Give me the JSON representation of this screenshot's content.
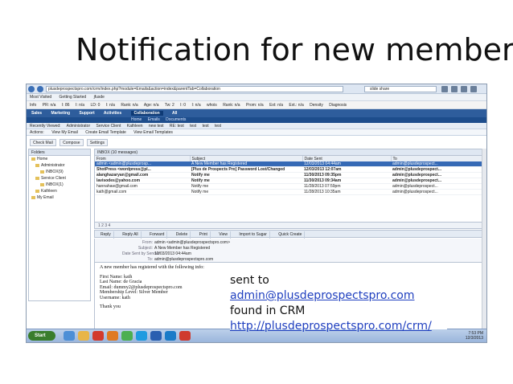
{
  "slide": {
    "title": "Notification for new member"
  },
  "browser": {
    "url": "plusdeprospectspro.com/crm/index.php?module=Emails&action=index&parentTab=Collaboration",
    "search_value": "slide share",
    "bookmarks": [
      "Most Visited",
      "Getting Started",
      "jfusde"
    ],
    "extensions": [
      "Info",
      "PR: n/a",
      "I: 86",
      "I: n/a",
      "LD: 0",
      "I: n/a",
      "Rank: n/a",
      "Age: n/a",
      "Tw: 2",
      "I: 0",
      "I: n/a",
      "whois",
      "Rank: n/a",
      "Prom: n/a",
      "Ext: n/a",
      "Ext.: n/a",
      "Density",
      "Diagnosis"
    ]
  },
  "crm": {
    "tabs": [
      "Sales",
      "Marketing",
      "Support",
      "Activities",
      "Collaboration",
      "All"
    ],
    "active_tab": "Collaboration",
    "subtabs": [
      "Home",
      "Emails",
      "Documents"
    ],
    "recent_label": "Recently Viewed:",
    "recent_items": [
      "Administrator",
      "Service Client",
      "Kathleen",
      "new test",
      "RE: test",
      "test",
      "test",
      "test"
    ],
    "actions_label": "Actions:",
    "actions": [
      "View My Email",
      "Create Email Template",
      "View Email Templates"
    ]
  },
  "mail": {
    "toolbar": [
      "Check Mail",
      "Compose",
      "Settings"
    ],
    "folders_header": "Folders",
    "folders": [
      "Home",
      "Administrator",
      "INBOX(9)",
      "Service Client",
      "INBOX(1)",
      "Kathleen",
      "My Email"
    ],
    "list_title": "INBOX (10 messages)",
    "columns": [
      "From",
      "Subject",
      "Date Sent",
      "To"
    ],
    "rows": [
      [
        "admin <admin@plusdeprosp...",
        "A New Member has Registered",
        "12/03/2013 04:44am",
        "admin@plusdeprospect..."
      ],
      [
        "ShotPress <wordpress@pl...",
        "[Plus de Prospects Pro] Password Lost/Changed",
        "12/03/2013 12:07am",
        "admin@plusdeprospect..."
      ],
      [
        "alanghazaryan@gmail.com",
        "Notify me",
        "11/30/2013 09:35pm",
        "admin@plusdeprospect..."
      ],
      [
        "lavisodes@yahoo.com",
        "Notify me",
        "11/30/2013 09:34am",
        "admin@plusdeprospect..."
      ],
      [
        "hannahaw@gmail.com",
        "Notify me",
        "11/28/2013 07:59pm",
        "admin@plusdeprospect..."
      ],
      [
        "kath@gmail.com",
        "Notify me",
        "11/28/2013 10:35am",
        "admin@plusdeprospect..."
      ]
    ],
    "pager": "1 2 3 4",
    "view_toolbar": [
      "Reply",
      "Reply All",
      "Forward",
      "Delete",
      "Print",
      "View",
      "Import to Sugar",
      "Quick Create"
    ],
    "header_keys": [
      "From:",
      "Subject:",
      "Date Sent by Sender:",
      "To:"
    ],
    "header_values": [
      "admin <admin@plusdeprospectspro.com>",
      "A New Member has Registered",
      "12/03/2013 04:44am",
      "admin@plusdeprospectspro.com"
    ],
    "body_lines": [
      "A new member has registered with the following info:",
      "",
      "First Name: kath",
      "Last Name: de Gracia",
      "Email: dummy2@plusdeprospectspro.com",
      "Membership Level: Silver Member",
      "Username: kath",
      "",
      "Thank you"
    ]
  },
  "taskbar": {
    "start": "Start",
    "time": "7:53 PM",
    "date": "12/3/2013"
  },
  "note": {
    "prefix": "sent to ",
    "email": "admin@plusdeprospectspro.com",
    "line2": "found in CRM",
    "url": "http://plusdeprospectspro.com/crm/"
  },
  "colors": {
    "crm_nav": "#2e5d9c",
    "selected_row": "#3569b5",
    "link": "#1f3fbf"
  }
}
